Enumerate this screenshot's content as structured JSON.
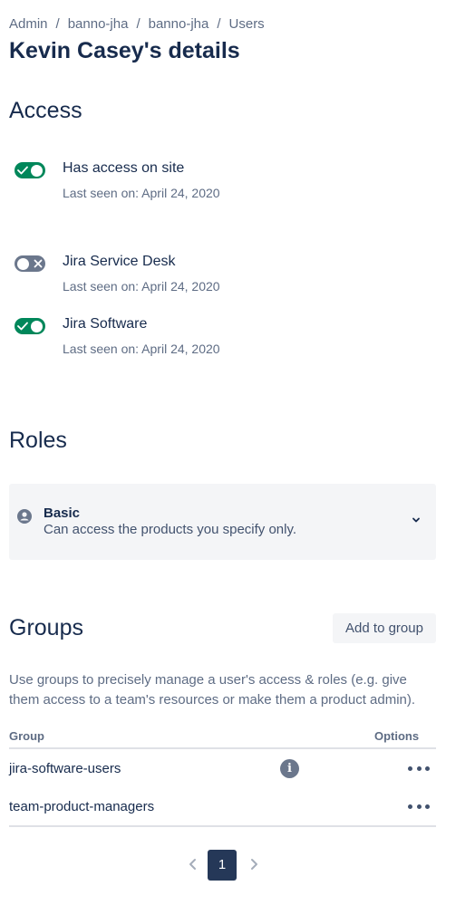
{
  "breadcrumb": [
    "Admin",
    "banno-jha",
    "banno-jha",
    "Users"
  ],
  "page_title": "Kevin Casey's details",
  "access": {
    "title": "Access",
    "items": [
      {
        "label": "Has access on site",
        "last_seen": "Last seen on: April 24, 2020",
        "enabled": true
      },
      {
        "label": "Jira Service Desk",
        "last_seen": "Last seen on: April 24, 2020",
        "enabled": false
      },
      {
        "label": "Jira Software",
        "last_seen": "Last seen on: April 24, 2020",
        "enabled": true
      }
    ]
  },
  "roles": {
    "title": "Roles",
    "role": {
      "name": "Basic",
      "description": "Can access the products you specify only."
    }
  },
  "groups": {
    "title": "Groups",
    "add_label": "Add to group",
    "description": "Use groups to precisely manage a user's access & roles (e.g. give them access to a team's resources or make them a product admin).",
    "columns": {
      "group": "Group",
      "options": "Options"
    },
    "rows": [
      {
        "name": "jira-software-users",
        "has_info": true
      },
      {
        "name": "team-product-managers",
        "has_info": false
      }
    ]
  },
  "pagination": {
    "current_page": "1"
  },
  "colors": {
    "toggle_on": "#00875A",
    "toggle_off": "#6B778C",
    "active_page": "#253858"
  }
}
